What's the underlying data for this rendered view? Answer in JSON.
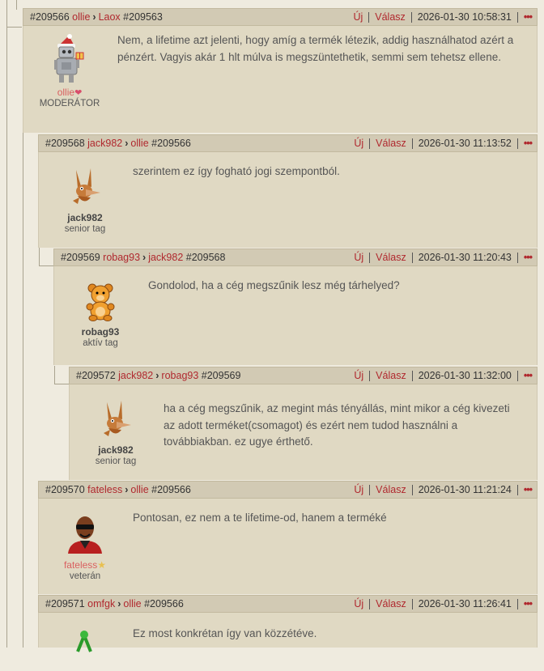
{
  "header_actions": {
    "new": "Új",
    "reply": "Válasz",
    "more": "•••"
  },
  "posts": [
    {
      "id": "#209566",
      "author": "ollie",
      "reply_to_user": "Laox",
      "reply_to_id": "#209563",
      "timestamp": "2026-01-30 10:58:31",
      "text": "Nem, a lifetime azt jelenti, hogy amíg a termék létezik, addig használhatod azért a pénzért. Vagyis akár 1 hlt múlva is megszüntethetik, semmi sem tehetsz ellene.",
      "user_name": "ollie",
      "user_rank": "MODERÁTOR",
      "avatar": "robot-santa-avatar"
    },
    {
      "id": "#209568",
      "author": "jack982",
      "reply_to_user": "ollie",
      "reply_to_id": "#209566",
      "timestamp": "2026-01-30 11:13:52",
      "text": "szerintem ez így fogható jogi szempontból.",
      "user_name": "jack982",
      "user_rank": "senior tag",
      "avatar": "rabbit-avatar"
    },
    {
      "id": "#209569",
      "author": "robag93",
      "reply_to_user": "jack982",
      "reply_to_id": "#209568",
      "timestamp": "2026-01-30 11:20:43",
      "text": "Gondolod, ha a cég megszűnik lesz még tárhelyed?",
      "user_name": "robag93",
      "user_rank": "aktív tag",
      "avatar": "teddy-bear-avatar"
    },
    {
      "id": "#209572",
      "author": "jack982",
      "reply_to_user": "robag93",
      "reply_to_id": "#209569",
      "timestamp": "2026-01-30 11:32:00",
      "text": "ha a cég megszűnik, az megint más tényállás, mint mikor a cég kivezeti az adott terméket(csomagot) és ezért nem tudod használni a továbbiakban. ez ugye érthető.",
      "user_name": "jack982",
      "user_rank": "senior tag",
      "avatar": "rabbit-avatar"
    },
    {
      "id": "#209570",
      "author": "fateless",
      "reply_to_user": "ollie",
      "reply_to_id": "#209566",
      "timestamp": "2026-01-30 11:21:24",
      "text": "Pontosan, ez nem a te lifetime-od, hanem a terméké",
      "user_name": "fateless",
      "user_rank": "veterán",
      "avatar": "man-sunglasses-avatar"
    },
    {
      "id": "#209571",
      "author": "omfgk",
      "reply_to_user": "ollie",
      "reply_to_id": "#209566",
      "timestamp": "2026-01-30 11:26:41",
      "text": "Ez most konkrétan így van közzétéve.",
      "user_name": "",
      "user_rank": "",
      "avatar": "green-figure-avatar"
    }
  ]
}
